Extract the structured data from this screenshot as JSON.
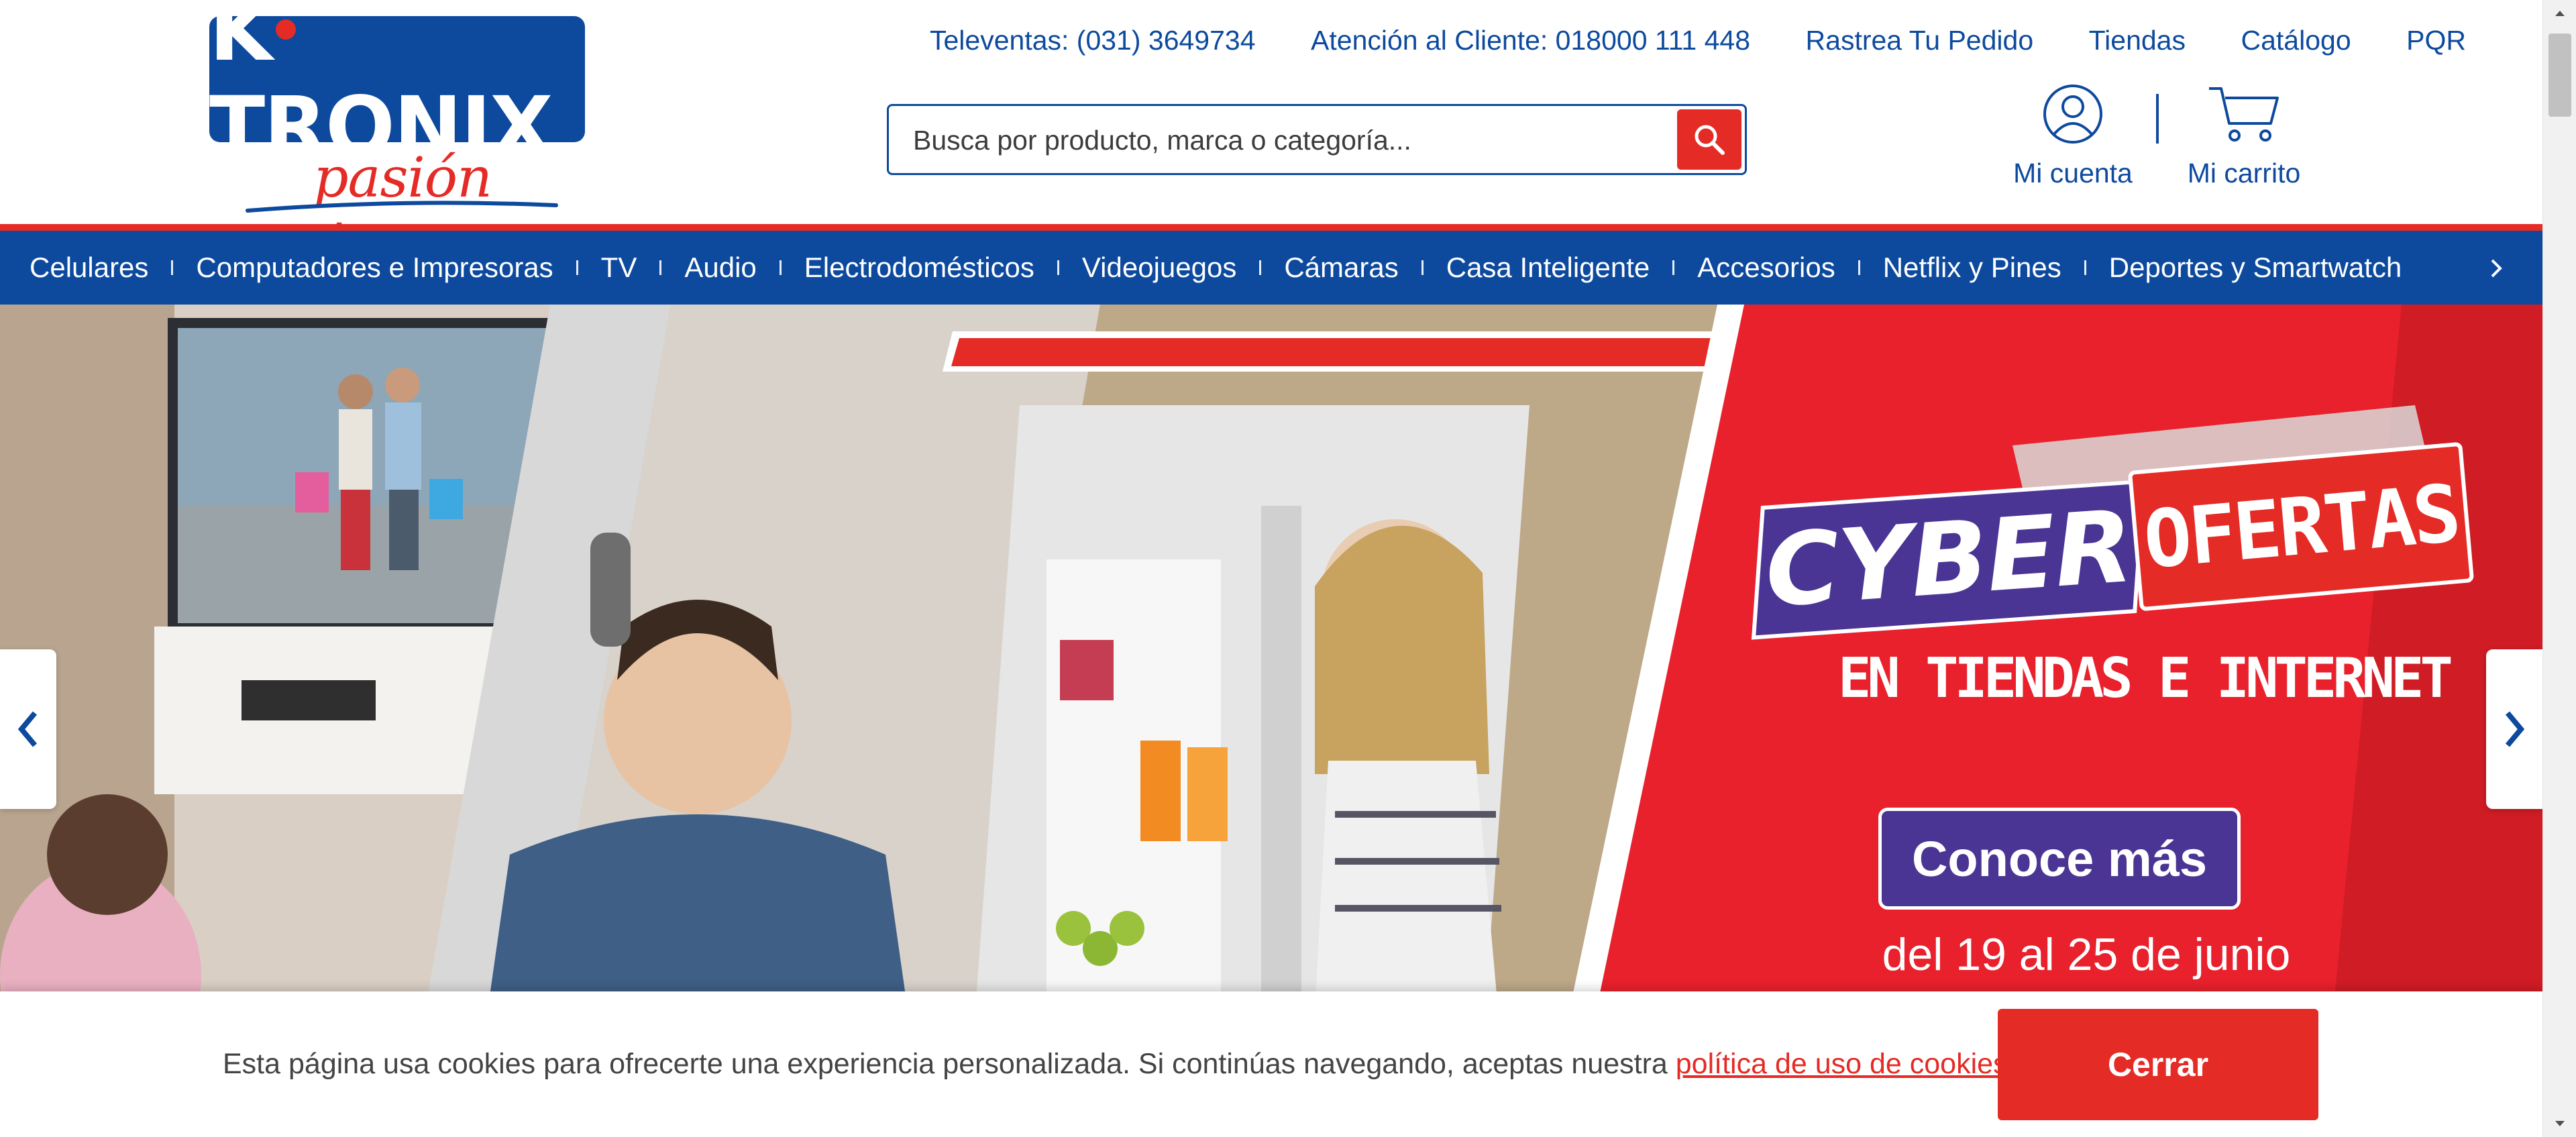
{
  "brand": {
    "name": "K·TRONIX",
    "name_left": "K",
    "name_right": "TRONIX",
    "tagline": "pasión tecno",
    "colors": {
      "primary": "#0d4a9e",
      "accent": "#e52b26",
      "promo_purple": "#4b3594"
    }
  },
  "top_links": [
    "Televentas: (031) 3649734",
    "Atención al Cliente: 018000 111 448",
    "Rastrea Tu Pedido",
    "Tiendas",
    "Catálogo",
    "PQR"
  ],
  "search": {
    "placeholder": "Busca por producto, marca o categoría...",
    "value": "",
    "icon": "search-icon"
  },
  "account": {
    "label": "Mi cuenta",
    "icon": "user-icon"
  },
  "cart": {
    "label": "Mi carrito",
    "icon": "cart-icon"
  },
  "categories": [
    "Celulares",
    "Computadores e Impresoras",
    "TV",
    "Audio",
    "Electrodomésticos",
    "Videojuegos",
    "Cámaras",
    "Casa Inteligente",
    "Accesorios",
    "Netflix y Pines",
    "Deportes y Smartwatch"
  ],
  "hero": {
    "headline_left": "CYBER",
    "headline_right": "OFERTAS",
    "subtitle": "EN TIENDAS E INTERNET",
    "cta": "Conoce más",
    "dates": "del 19 al 25 de junio",
    "icons": {
      "prev": "chevron-left-icon",
      "next": "chevron-right-icon"
    }
  },
  "cookie_bar": {
    "text": "Esta página usa cookies para ofrecerte una experiencia personalizada. Si continúas navegando, aceptas nuestra ",
    "link": "política de uso de cookies",
    "period": ".",
    "button": "Cerrar"
  }
}
